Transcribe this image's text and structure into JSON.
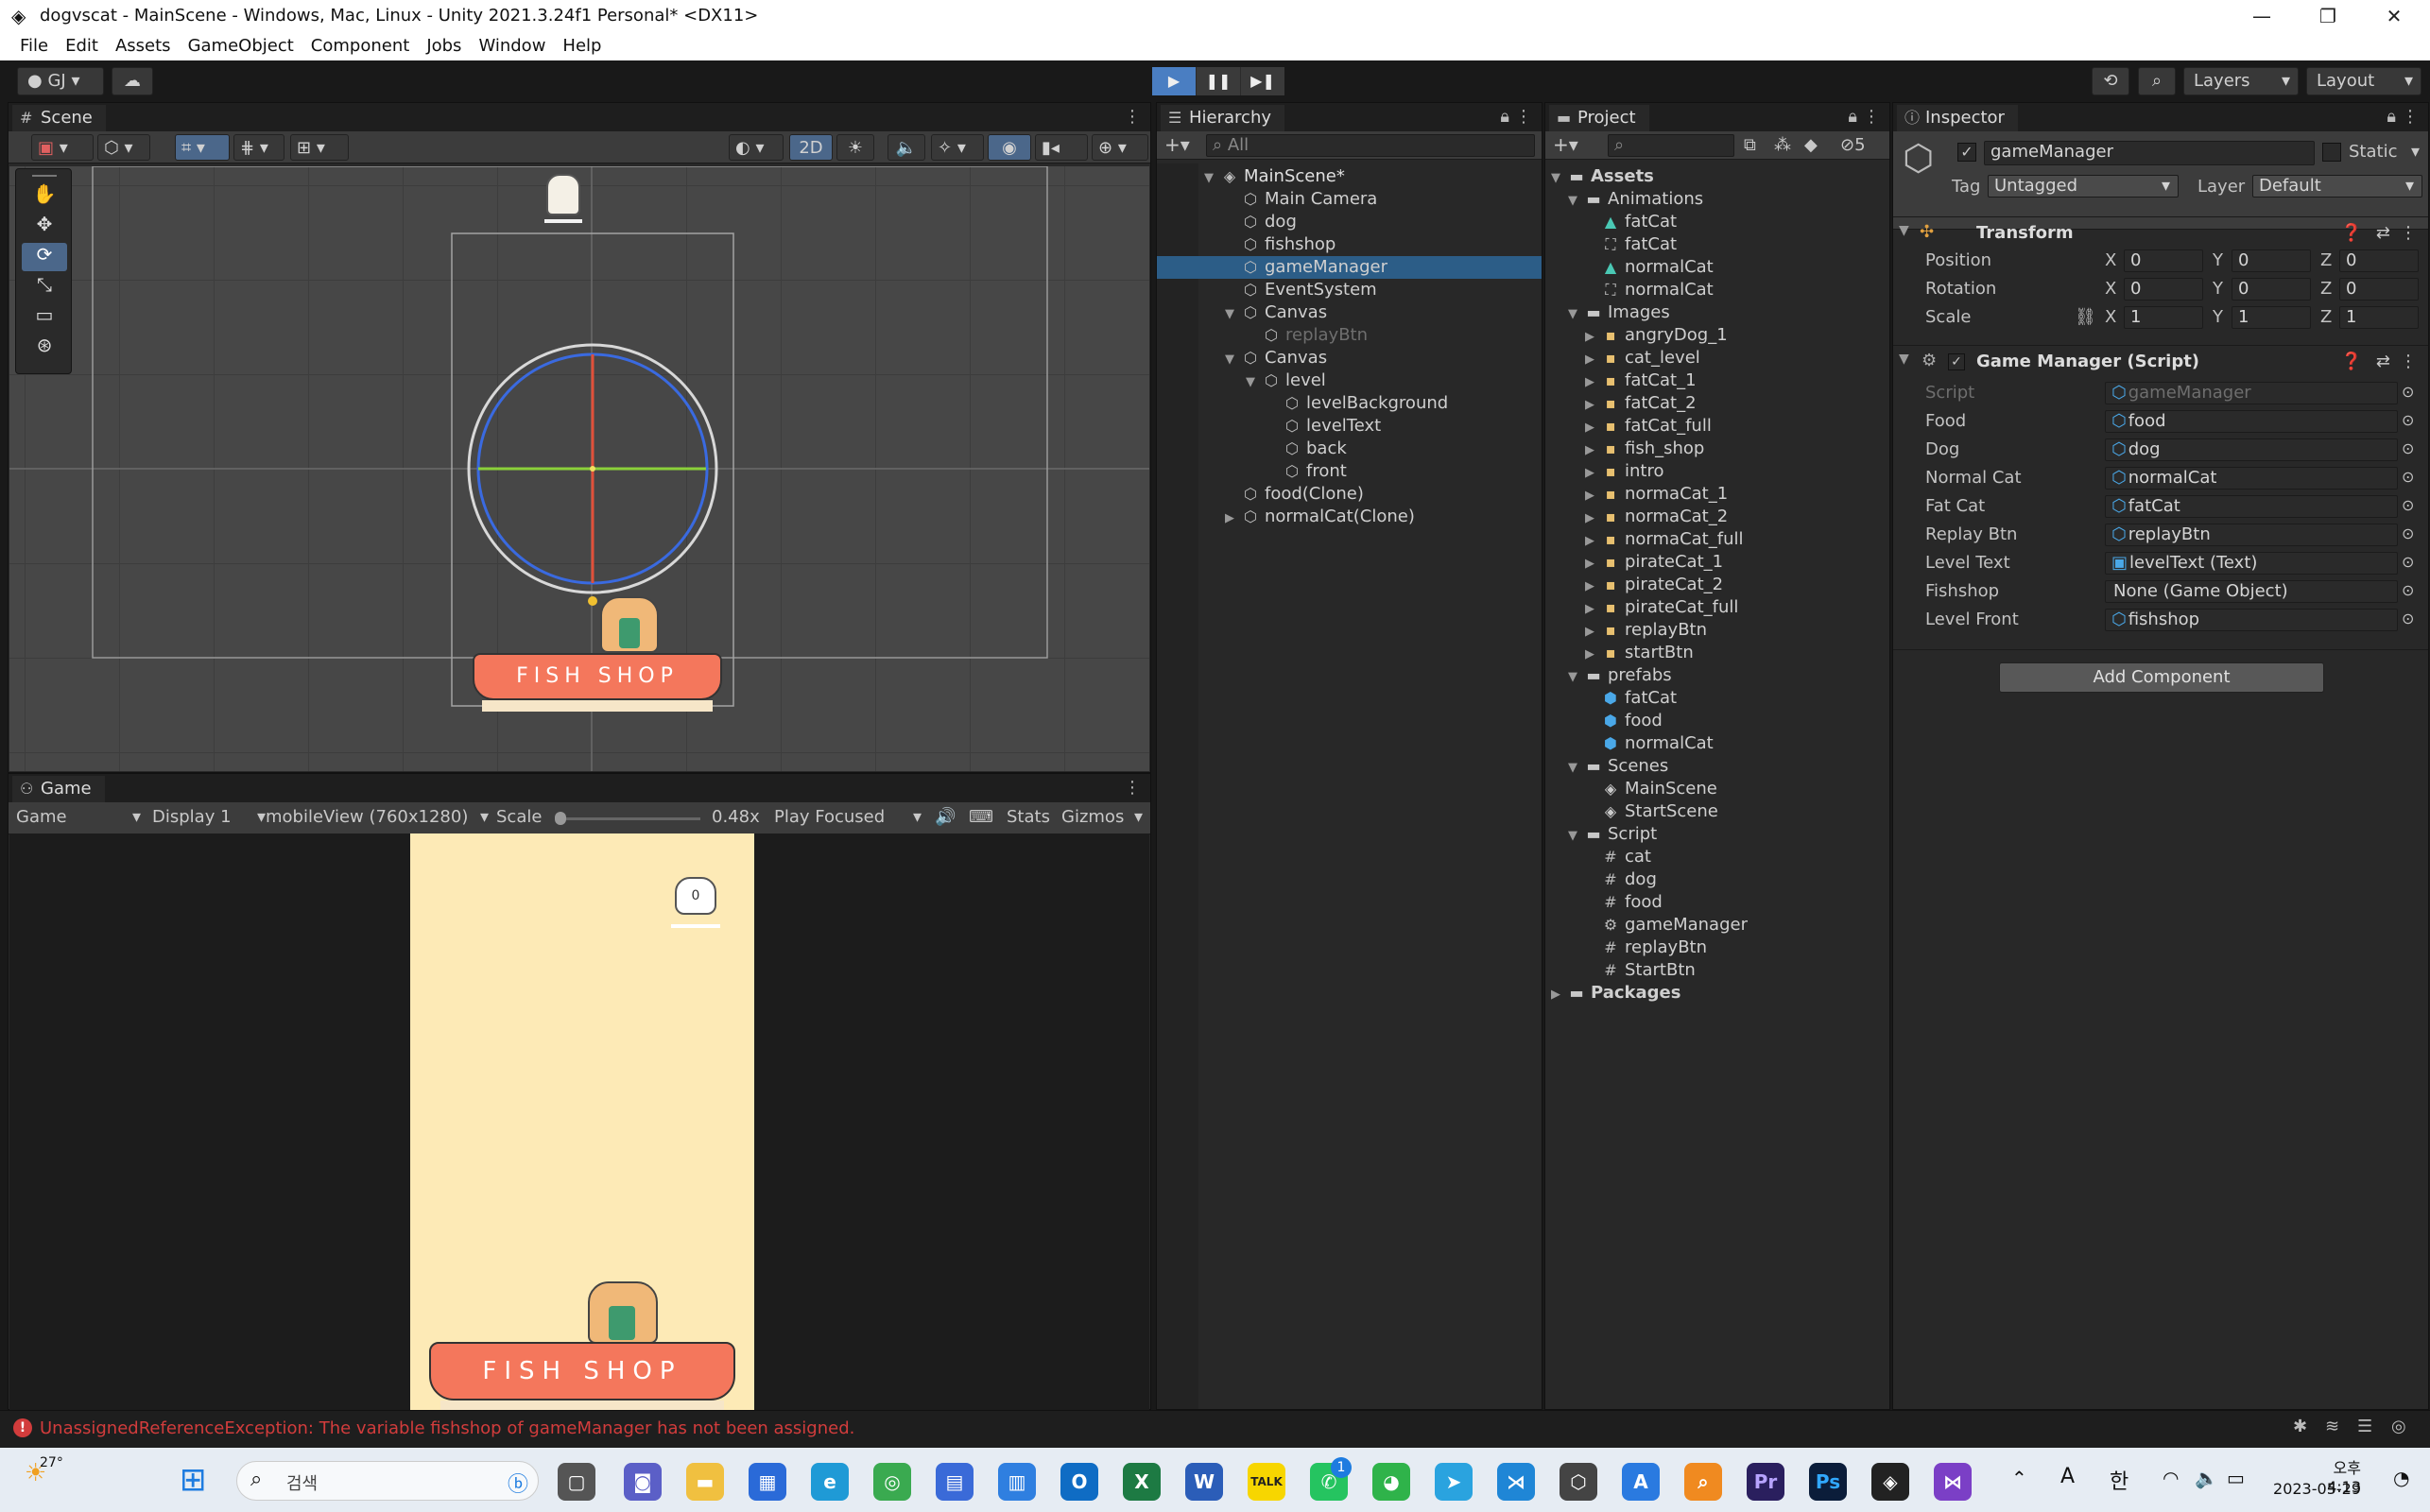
{
  "window": {
    "title": "dogvscat - MainScene - Windows, Mac, Linux - Unity 2021.3.24f1 Personal* <DX11>"
  },
  "menu": [
    "File",
    "Edit",
    "Assets",
    "GameObject",
    "Component",
    "Jobs",
    "Window",
    "Help"
  ],
  "toolbar": {
    "account": "GJ",
    "layers": "Layers",
    "layout": "Layout"
  },
  "scene": {
    "tab": "Scene",
    "mode_2d": "2D"
  },
  "game": {
    "tab": "Game",
    "display_mode": "Game",
    "display": "Display 1",
    "resolution": "mobileView (760x1280)",
    "scale_label": "Scale",
    "scale_value": "0.48x",
    "play_mode": "Play Focused",
    "stats": "Stats",
    "gizmos": "Gizmos",
    "score_text": "0",
    "shop_sign": "FISH SHOP"
  },
  "hierarchy": {
    "tab": "Hierarchy",
    "search_placeholder": "All",
    "items": [
      {
        "label": "MainScene*",
        "depth": 0,
        "kind": "scene"
      },
      {
        "label": "Main Camera",
        "depth": 1,
        "kind": "object"
      },
      {
        "label": "dog",
        "depth": 1,
        "kind": "object"
      },
      {
        "label": "fishshop",
        "depth": 1,
        "kind": "object"
      },
      {
        "label": "gameManager",
        "depth": 1,
        "kind": "object",
        "selected": true
      },
      {
        "label": "EventSystem",
        "depth": 1,
        "kind": "object"
      },
      {
        "label": "Canvas",
        "depth": 1,
        "kind": "object",
        "expanded": true
      },
      {
        "label": "replayBtn",
        "depth": 2,
        "kind": "object",
        "disabled": true
      },
      {
        "label": "Canvas",
        "depth": 1,
        "kind": "object",
        "expanded": true
      },
      {
        "label": "level",
        "depth": 2,
        "kind": "object",
        "expanded": true
      },
      {
        "label": "levelBackground",
        "depth": 3,
        "kind": "object"
      },
      {
        "label": "levelText",
        "depth": 3,
        "kind": "object"
      },
      {
        "label": "back",
        "depth": 3,
        "kind": "object"
      },
      {
        "label": "front",
        "depth": 3,
        "kind": "object"
      },
      {
        "label": "food(Clone)",
        "depth": 1,
        "kind": "object"
      },
      {
        "label": "normalCat(Clone)",
        "depth": 1,
        "kind": "object"
      }
    ]
  },
  "project": {
    "tab": "Project",
    "hidden_count": "5",
    "items": [
      {
        "label": "Assets",
        "depth": 0,
        "kind": "folder",
        "bold": true
      },
      {
        "label": "Animations",
        "depth": 1,
        "kind": "folder"
      },
      {
        "label": "fatCat",
        "depth": 2,
        "kind": "anim"
      },
      {
        "label": "fatCat",
        "depth": 2,
        "kind": "controller"
      },
      {
        "label": "normalCat",
        "depth": 2,
        "kind": "anim"
      },
      {
        "label": "normalCat",
        "depth": 2,
        "kind": "controller"
      },
      {
        "label": "Images",
        "depth": 1,
        "kind": "folder"
      },
      {
        "label": "angryDog_1",
        "depth": 2,
        "kind": "sprite"
      },
      {
        "label": "cat_level",
        "depth": 2,
        "kind": "sprite"
      },
      {
        "label": "fatCat_1",
        "depth": 2,
        "kind": "sprite"
      },
      {
        "label": "fatCat_2",
        "depth": 2,
        "kind": "sprite"
      },
      {
        "label": "fatCat_full",
        "depth": 2,
        "kind": "sprite"
      },
      {
        "label": "fish_shop",
        "depth": 2,
        "kind": "sprite"
      },
      {
        "label": "intro",
        "depth": 2,
        "kind": "sprite"
      },
      {
        "label": "normaCat_1",
        "depth": 2,
        "kind": "sprite"
      },
      {
        "label": "normaCat_2",
        "depth": 2,
        "kind": "sprite"
      },
      {
        "label": "normaCat_full",
        "depth": 2,
        "kind": "sprite"
      },
      {
        "label": "pirateCat_1",
        "depth": 2,
        "kind": "sprite"
      },
      {
        "label": "pirateCat_2",
        "depth": 2,
        "kind": "sprite"
      },
      {
        "label": "pirateCat_full",
        "depth": 2,
        "kind": "sprite"
      },
      {
        "label": "replayBtn",
        "depth": 2,
        "kind": "sprite"
      },
      {
        "label": "startBtn",
        "depth": 2,
        "kind": "sprite"
      },
      {
        "label": "prefabs",
        "depth": 1,
        "kind": "folder"
      },
      {
        "label": "fatCat",
        "depth": 2,
        "kind": "prefab"
      },
      {
        "label": "food",
        "depth": 2,
        "kind": "prefab"
      },
      {
        "label": "normalCat",
        "depth": 2,
        "kind": "prefab"
      },
      {
        "label": "Scenes",
        "depth": 1,
        "kind": "folder"
      },
      {
        "label": "MainScene",
        "depth": 2,
        "kind": "scene"
      },
      {
        "label": "StartScene",
        "depth": 2,
        "kind": "scene"
      },
      {
        "label": "Script",
        "depth": 1,
        "kind": "folder"
      },
      {
        "label": "cat",
        "depth": 2,
        "kind": "script"
      },
      {
        "label": "dog",
        "depth": 2,
        "kind": "script"
      },
      {
        "label": "food",
        "depth": 2,
        "kind": "script"
      },
      {
        "label": "gameManager",
        "depth": 2,
        "kind": "gear"
      },
      {
        "label": "replayBtn",
        "depth": 2,
        "kind": "script"
      },
      {
        "label": "StartBtn",
        "depth": 2,
        "kind": "script"
      },
      {
        "label": "Packages",
        "depth": 0,
        "kind": "folder",
        "bold": true
      }
    ]
  },
  "inspector": {
    "tab": "Inspector",
    "object_name": "gameManager",
    "static_label": "Static",
    "tag_label": "Tag",
    "tag_value": "Untagged",
    "layer_label": "Layer",
    "layer_value": "Default",
    "transform": {
      "title": "Transform",
      "rows": [
        {
          "label": "Position",
          "x": "0",
          "y": "0",
          "z": "0"
        },
        {
          "label": "Rotation",
          "x": "0",
          "y": "0",
          "z": "0"
        },
        {
          "label": "Scale",
          "x": "1",
          "y": "1",
          "z": "1"
        }
      ]
    },
    "script_component": {
      "title": "Game Manager (Script)",
      "fields": [
        {
          "label": "Script",
          "value": "gameManager",
          "disabled": true
        },
        {
          "label": "Food",
          "value": "food"
        },
        {
          "label": "Dog",
          "value": "dog"
        },
        {
          "label": "Normal Cat",
          "value": "normalCat"
        },
        {
          "label": "Fat Cat",
          "value": "fatCat"
        },
        {
          "label": "Replay Btn",
          "value": "replayBtn"
        },
        {
          "label": "Level Text",
          "value": "levelText (Text)"
        },
        {
          "label": "Fishshop",
          "value": "None (Game Object)"
        },
        {
          "label": "Level Front",
          "value": "fishshop"
        }
      ]
    },
    "add_component": "Add Component"
  },
  "console": {
    "error": "UnassignedReferenceException: The variable fishshop of gameManager has not been assigned."
  },
  "taskbar": {
    "weather": "27°",
    "search": "검색",
    "ime_a": "A",
    "ime_han": "한",
    "time": "오후 4:13",
    "date": "2023-05-29",
    "badge": "1"
  },
  "colors": {
    "accent": "#2c5d87",
    "error": "#d23c3c",
    "awning": "#f4775c",
    "game_bg": "#fdeab6"
  }
}
